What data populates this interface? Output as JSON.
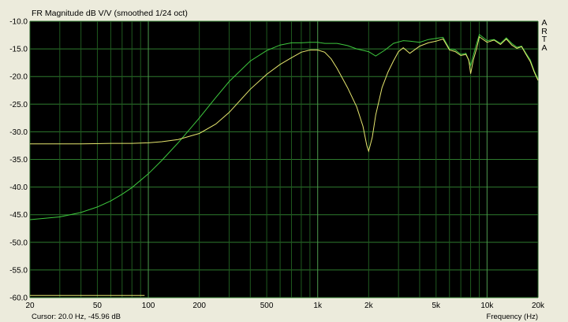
{
  "chart_data": {
    "type": "line",
    "title": "FR Magnitude dB V/V (smoothed 1/24 oct)",
    "xlabel": "Frequency (Hz)",
    "ylabel": "",
    "x_scale": "log",
    "xlim": [
      20,
      20000
    ],
    "ylim": [
      -60,
      -10
    ],
    "grid": true,
    "x_tick_labels": [
      {
        "value": 20,
        "label": "20"
      },
      {
        "value": 50,
        "label": "50"
      },
      {
        "value": 100,
        "label": "100"
      },
      {
        "value": 200,
        "label": "200"
      },
      {
        "value": 500,
        "label": "500"
      },
      {
        "value": 1000,
        "label": "1k"
      },
      {
        "value": 2000,
        "label": "2k"
      },
      {
        "value": 5000,
        "label": "5k"
      },
      {
        "value": 10000,
        "label": "10k"
      },
      {
        "value": 20000,
        "label": "20k"
      }
    ],
    "y_ticks": [
      -10,
      -15,
      -20,
      -25,
      -30,
      -35,
      -40,
      -45,
      -50,
      -55,
      -60
    ],
    "y_tick_labels": [
      "-10.0",
      "-15.0",
      "-20.0",
      "-25.0",
      "-30.0",
      "-35.0",
      "-40.0",
      "-45.0",
      "-50.0",
      "-55.0",
      "-60.0"
    ],
    "series": [
      {
        "color": "#3ec83e",
        "points": [
          [
            20,
            -45.9
          ],
          [
            30,
            -45.4
          ],
          [
            40,
            -44.6
          ],
          [
            50,
            -43.6
          ],
          [
            60,
            -42.5
          ],
          [
            70,
            -41.3
          ],
          [
            80,
            -40.1
          ],
          [
            100,
            -37.6
          ],
          [
            120,
            -35.2
          ],
          [
            150,
            -32.0
          ],
          [
            200,
            -27.5
          ],
          [
            250,
            -23.8
          ],
          [
            300,
            -20.9
          ],
          [
            400,
            -17.2
          ],
          [
            500,
            -15.3
          ],
          [
            600,
            -14.3
          ],
          [
            700,
            -13.9
          ],
          [
            800,
            -13.9
          ],
          [
            900,
            -13.8
          ],
          [
            1000,
            -13.8
          ],
          [
            1100,
            -14.0
          ],
          [
            1300,
            -14.0
          ],
          [
            1500,
            -14.4
          ],
          [
            1700,
            -15.0
          ],
          [
            2000,
            -15.5
          ],
          [
            2200,
            -16.3
          ],
          [
            2500,
            -15.2
          ],
          [
            2800,
            -14.0
          ],
          [
            3200,
            -13.5
          ],
          [
            3500,
            -13.6
          ],
          [
            4000,
            -13.8
          ],
          [
            4500,
            -13.3
          ],
          [
            5000,
            -13.1
          ],
          [
            5500,
            -12.9
          ],
          [
            6000,
            -15.0
          ],
          [
            6500,
            -15.2
          ],
          [
            7000,
            -16.0
          ],
          [
            7500,
            -15.8
          ],
          [
            8000,
            -18.0
          ],
          [
            8500,
            -15.0
          ],
          [
            9000,
            -12.4
          ],
          [
            10000,
            -13.5
          ],
          [
            11000,
            -13.3
          ],
          [
            12000,
            -14.0
          ],
          [
            13000,
            -13.0
          ],
          [
            14000,
            -14.0
          ],
          [
            15000,
            -14.7
          ],
          [
            16000,
            -14.5
          ],
          [
            17000,
            -15.8
          ],
          [
            18000,
            -17.0
          ],
          [
            19000,
            -19.0
          ],
          [
            20000,
            -20.5
          ]
        ]
      },
      {
        "color": "#e6e66e",
        "points": [
          [
            20,
            -32.2
          ],
          [
            40,
            -32.2
          ],
          [
            60,
            -32.1
          ],
          [
            80,
            -32.1
          ],
          [
            100,
            -32.0
          ],
          [
            120,
            -31.8
          ],
          [
            150,
            -31.4
          ],
          [
            200,
            -30.3
          ],
          [
            250,
            -28.6
          ],
          [
            300,
            -26.5
          ],
          [
            400,
            -22.3
          ],
          [
            500,
            -19.6
          ],
          [
            600,
            -17.8
          ],
          [
            700,
            -16.6
          ],
          [
            800,
            -15.6
          ],
          [
            900,
            -15.2
          ],
          [
            1000,
            -15.2
          ],
          [
            1100,
            -15.6
          ],
          [
            1200,
            -16.8
          ],
          [
            1300,
            -18.5
          ],
          [
            1500,
            -22.0
          ],
          [
            1700,
            -25.5
          ],
          [
            1850,
            -29.0
          ],
          [
            1950,
            -32.5
          ],
          [
            2000,
            -33.5
          ],
          [
            2100,
            -31.0
          ],
          [
            2200,
            -27.0
          ],
          [
            2400,
            -22.0
          ],
          [
            2600,
            -19.2
          ],
          [
            2800,
            -17.2
          ],
          [
            3000,
            -15.5
          ],
          [
            3200,
            -14.8
          ],
          [
            3500,
            -15.8
          ],
          [
            4000,
            -14.5
          ],
          [
            4500,
            -13.9
          ],
          [
            5000,
            -13.6
          ],
          [
            5500,
            -13.2
          ],
          [
            6000,
            -15.2
          ],
          [
            6500,
            -15.5
          ],
          [
            7000,
            -16.2
          ],
          [
            7500,
            -16.0
          ],
          [
            7800,
            -17.0
          ],
          [
            8000,
            -19.5
          ],
          [
            8300,
            -17.0
          ],
          [
            8700,
            -14.8
          ],
          [
            9000,
            -12.8
          ],
          [
            10000,
            -13.8
          ],
          [
            11000,
            -13.4
          ],
          [
            12000,
            -14.2
          ],
          [
            13000,
            -13.2
          ],
          [
            14000,
            -14.3
          ],
          [
            15000,
            -14.9
          ],
          [
            16000,
            -14.6
          ],
          [
            17000,
            -16.0
          ],
          [
            18000,
            -17.3
          ],
          [
            19000,
            -19.2
          ],
          [
            20000,
            -20.7
          ]
        ]
      },
      {
        "color": "#e6e66e",
        "points": [
          [
            20,
            -59.6
          ],
          [
            95,
            -59.6
          ]
        ]
      }
    ]
  },
  "frame": {
    "arta": [
      "A",
      "R",
      "T",
      "A"
    ],
    "cursor_text": "Cursor: 20.0 Hz, -45.96 dB"
  }
}
